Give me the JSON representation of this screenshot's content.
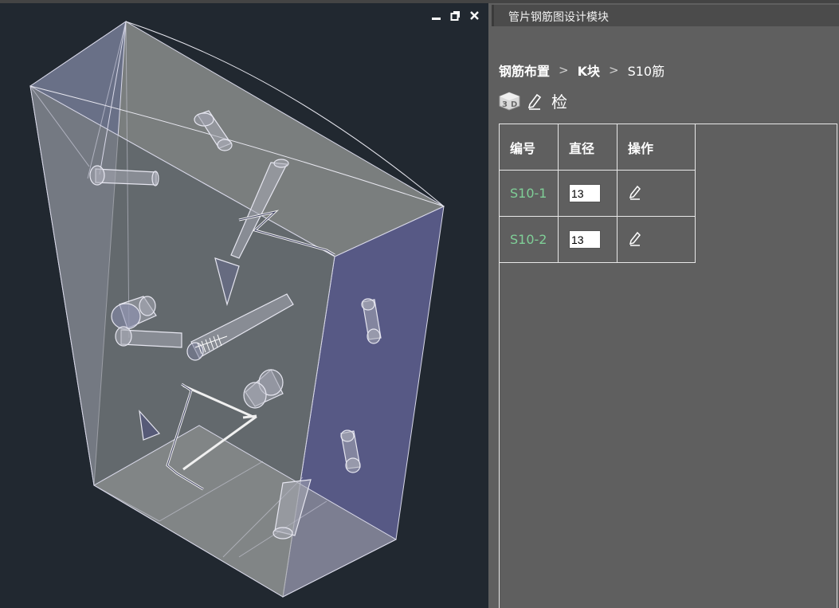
{
  "panel": {
    "title": "管片钢筋图设计模块"
  },
  "breadcrumb": [
    {
      "label": "钢筋布置"
    },
    {
      "label": "K块"
    },
    {
      "label": "S10筋"
    }
  ],
  "breadcrumb_separator": ">",
  "toolbar": {
    "view3d_icon": "3d-cube-icon",
    "edit_icon": "pencil-icon",
    "check_label": "检"
  },
  "table": {
    "headers": [
      "编号",
      "直径",
      "操作"
    ],
    "rows": [
      {
        "code": "S10-1",
        "diameter": "13",
        "action_icon": "pencil-icon"
      },
      {
        "code": "S10-2",
        "diameter": "13",
        "action_icon": "pencil-icon"
      }
    ]
  },
  "viewport": {
    "controls": [
      "minimize-icon",
      "restore-icon",
      "close-icon"
    ]
  },
  "colors": {
    "viewport_bg": "#212830",
    "panel_bg": "#5f5f5f",
    "code_text": "#7fcf97",
    "face_front": "#8f9194",
    "face_right": "#5e5f8c"
  }
}
